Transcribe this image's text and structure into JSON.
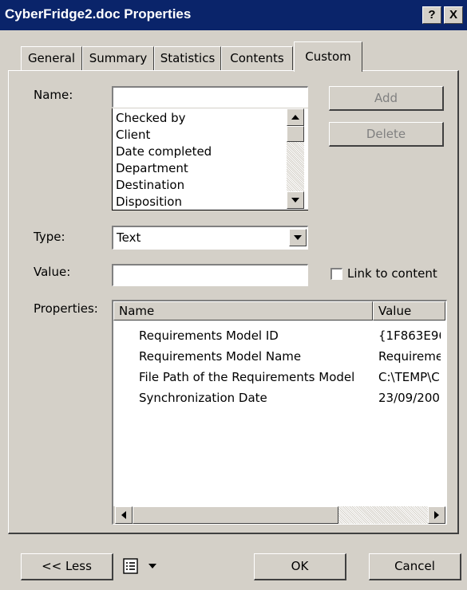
{
  "window": {
    "title": "CyberFridge2.doc Properties",
    "help_button": "?",
    "close_button": "X"
  },
  "tabs": [
    {
      "label": "General"
    },
    {
      "label": "Summary"
    },
    {
      "label": "Statistics"
    },
    {
      "label": "Contents"
    },
    {
      "label": "Custom",
      "active": true
    }
  ],
  "custom": {
    "name_label": "Name:",
    "name_value": "",
    "name_options": [
      "Checked by",
      "Client",
      "Date completed",
      "Department",
      "Destination",
      "Disposition"
    ],
    "add_button": "Add",
    "delete_button": "Delete",
    "type_label": "Type:",
    "type_value": "Text",
    "value_label": "Value:",
    "value_value": "",
    "link_to_content_label": "Link to content",
    "link_to_content_checked": false,
    "properties_label": "Properties:",
    "properties_columns": {
      "name": "Name",
      "value": "Value"
    },
    "properties_rows": [
      {
        "name": "Requirements Model ID",
        "value": "{1F863E96"
      },
      {
        "name": "Requirements Model Name",
        "value": "Requireme"
      },
      {
        "name": "File Path of the Requirements Model",
        "value": "C:\\TEMP\\C"
      },
      {
        "name": "Synchronization Date",
        "value": "23/09/200"
      }
    ]
  },
  "footer": {
    "less_button": "<< Less",
    "ok_button": "OK",
    "cancel_button": "Cancel"
  },
  "colors": {
    "titlebar": "#0a246a",
    "face": "#d4d0c8"
  }
}
